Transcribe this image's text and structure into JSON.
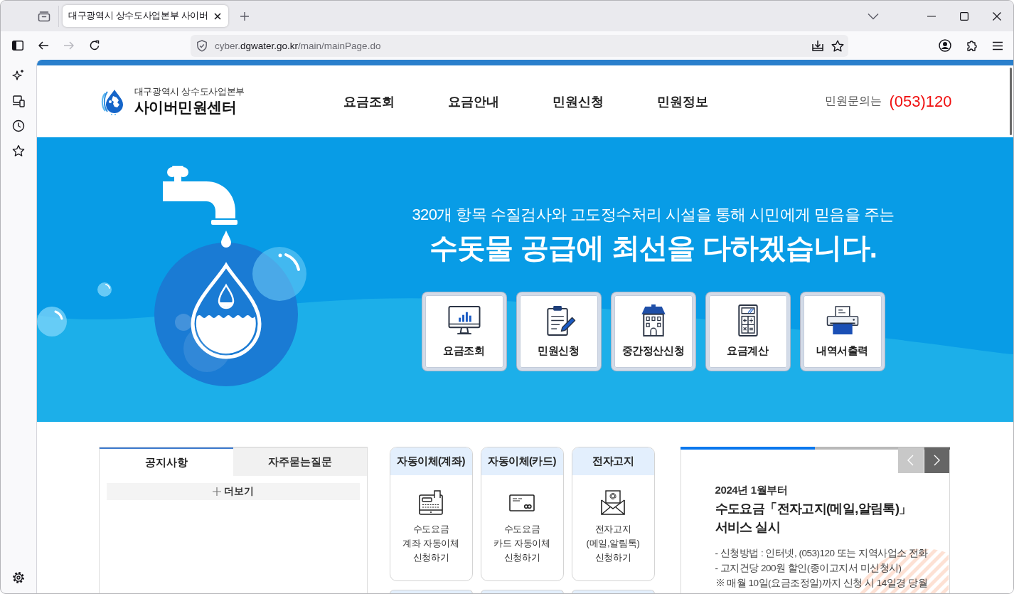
{
  "browser": {
    "tab": {
      "title": "대구광역시 상수도사업본부 사이버",
      "selected": true
    },
    "nav_buttons": [
      {
        "kind": "back",
        "disabled": false
      },
      {
        "kind": "forward",
        "disabled": true
      },
      {
        "kind": "reload",
        "disabled": false
      }
    ],
    "address": {
      "prefix": "cyber.",
      "domain": "dgwater.go.kr",
      "path": "/main/mainPage.do"
    }
  },
  "header": {
    "org": "대구광역시 상수도사업본부",
    "site_title": "사이버민원센터",
    "nav": [
      "요금조회",
      "요금안내",
      "민원신청",
      "민원정보"
    ],
    "contact_label": "민원문의는",
    "contact_phone": "(053)120"
  },
  "hero": {
    "subtitle": "320개 항목 수질검사와 고도정수처리 시설을 통해 시민에게 믿음을 주는",
    "headline": "수돗물 공급에 최선을 다하겠습니다.",
    "quick_menu": [
      "요금조회",
      "민원신청",
      "중간정산신청",
      "요금계산",
      "내역서출력"
    ]
  },
  "notice_panel": {
    "tabs": [
      {
        "label": "공지사항",
        "selected": true
      },
      {
        "label": "자주묻는질문",
        "selected": false
      }
    ],
    "more_label": "더보기"
  },
  "service_cards": [
    {
      "title": "자동이체(계좌)",
      "description": "수도요금\n계좌 자동이체\n신청하기"
    },
    {
      "title": "자동이체(카드)",
      "description": "수도요금\n카드 자동이체\n신청하기"
    },
    {
      "title": "전자고지",
      "description": "전자고지\n(메일,알림톡)\n신청하기"
    }
  ],
  "news_slider": {
    "progress": {
      "level": 0.5
    },
    "controls": [
      {
        "kind": "prev",
        "disabled": true
      },
      {
        "kind": "next",
        "disabled": false
      }
    ],
    "date_line": "2024년 1월부터",
    "title": "수도요금「전자고지(메일,알림톡)」\n서비스 실시",
    "items": [
      "- 신청방법 : 인터넷, (053)120 또는 지역사업소 전화",
      "- 고지건당 200원 할인(종이고지서 미신청시)",
      "※ 매월 10일(요금조정일)까지 신청 시 14일경 당월"
    ]
  }
}
